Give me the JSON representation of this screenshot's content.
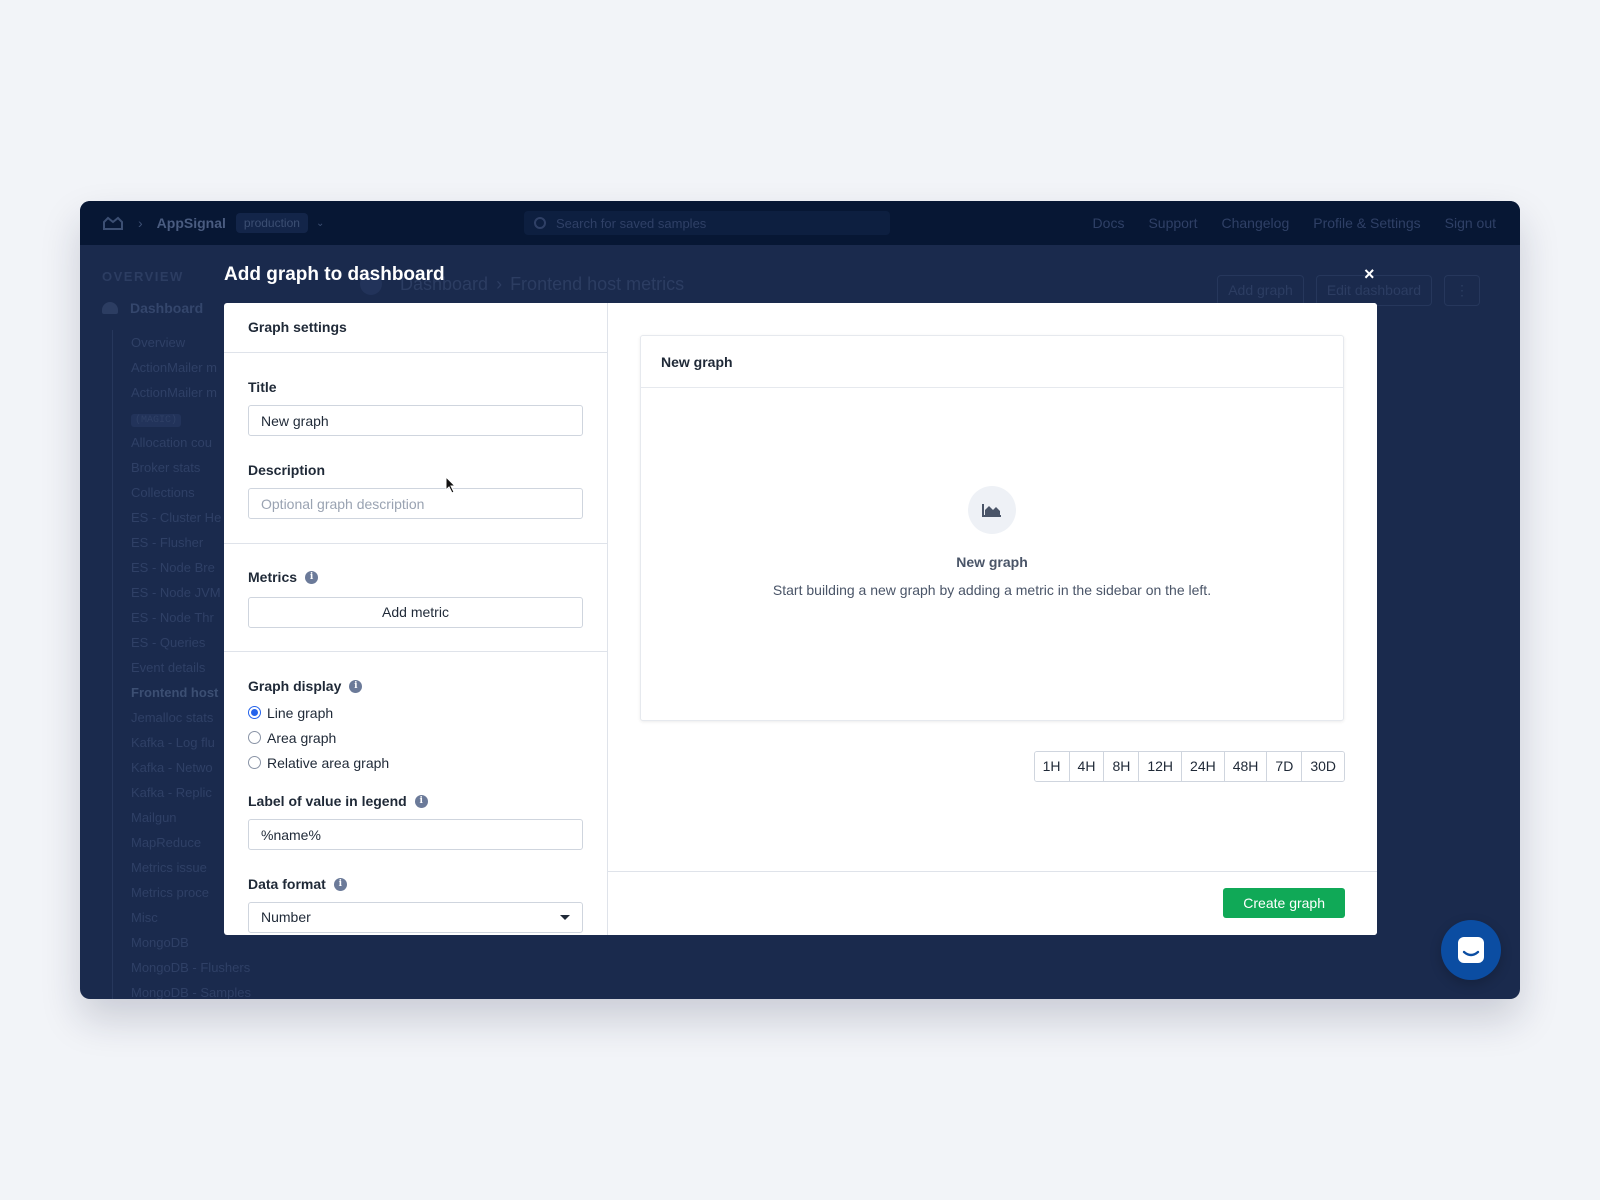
{
  "topbar": {
    "app_name": "AppSignal",
    "environment": "production",
    "search_placeholder": "Search for saved samples",
    "nav": [
      "Docs",
      "Support",
      "Changelog",
      "Profile & Settings",
      "Sign out"
    ]
  },
  "sidebar": {
    "section": "OVERVIEW",
    "dashboard_label": "Dashboard",
    "items": [
      {
        "label": "Overview"
      },
      {
        "label": "ActionMailer m"
      },
      {
        "label": "ActionMailer m"
      },
      {
        "label": "(MAGIC)",
        "tag": true
      },
      {
        "label": "Allocation cou"
      },
      {
        "label": "Broker stats"
      },
      {
        "label": "Collections"
      },
      {
        "label": "ES - Cluster He"
      },
      {
        "label": "ES - Flusher"
      },
      {
        "label": "ES - Node Bre"
      },
      {
        "label": "ES - Node JVM"
      },
      {
        "label": "ES - Node Thr"
      },
      {
        "label": "ES - Queries"
      },
      {
        "label": "Event details"
      },
      {
        "label": "Frontend host",
        "active": true
      },
      {
        "label": "Jemalloc stats"
      },
      {
        "label": "Kafka - Log flu"
      },
      {
        "label": "Kafka - Netwo"
      },
      {
        "label": "Kafka - Replic"
      },
      {
        "label": "Mailgun"
      },
      {
        "label": "MapReduce"
      },
      {
        "label": "Metrics issue"
      },
      {
        "label": "Metrics proce"
      },
      {
        "label": "Misc"
      },
      {
        "label": "MongoDB"
      },
      {
        "label": "MongoDB - Flushers"
      },
      {
        "label": "MongoDB - Samples"
      }
    ]
  },
  "page": {
    "breadcrumb_root": "Dashboard",
    "breadcrumb_current": "Frontend host metrics",
    "add_graph_label": "Add graph",
    "edit_dashboard_label": "Edit dashboard"
  },
  "modal": {
    "title": "Add graph to dashboard",
    "close_label": "×",
    "settings_header": "Graph settings",
    "title_label": "Title",
    "title_value": "New graph",
    "description_label": "Description",
    "description_placeholder": "Optional graph description",
    "metrics_label": "Metrics",
    "add_metric_label": "Add metric",
    "graph_display_label": "Graph display",
    "graph_display_options": [
      {
        "label": "Line graph",
        "checked": true
      },
      {
        "label": "Area graph",
        "checked": false
      },
      {
        "label": "Relative area graph",
        "checked": false
      }
    ],
    "legend_label": "Label of value in legend",
    "legend_value": "%name%",
    "data_format_label": "Data format",
    "data_format_value": "Number",
    "preview_title": "New graph",
    "empty_title": "New graph",
    "empty_description": "Start building a new graph by adding a metric in the sidebar on the left.",
    "time_ranges": [
      "1H",
      "4H",
      "8H",
      "12H",
      "24H",
      "48H",
      "7D",
      "30D"
    ],
    "create_label": "Create graph"
  },
  "colors": {
    "primary_button": "#10a957",
    "overlay": "#1a2a4d",
    "chat_launcher": "#0b4da2",
    "radio_checked": "#2563eb"
  },
  "icons": [
    "appsignal-logo-icon",
    "search-icon",
    "dashboard-icon",
    "info-icon",
    "area-chart-icon",
    "close-icon",
    "chat-icon",
    "cursor-icon"
  ]
}
